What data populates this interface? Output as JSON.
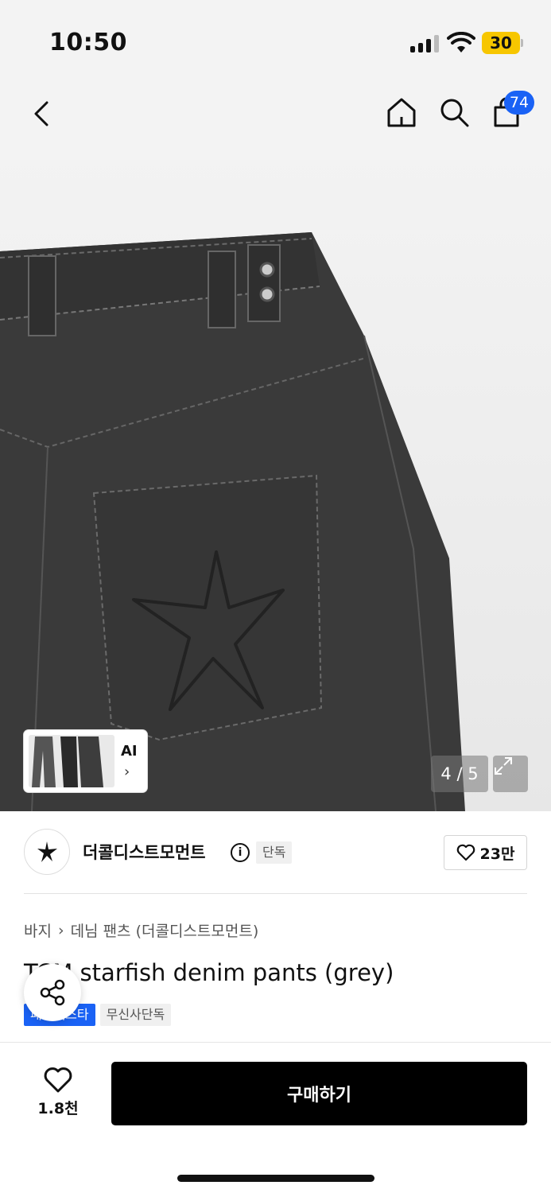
{
  "status_bar": {
    "time": "10:50",
    "battery": "30",
    "battery_color": "#f7c600",
    "icons": [
      "signal-icon",
      "wifi-icon",
      "battery-icon"
    ]
  },
  "header": {
    "icons": [
      "back-arrow-icon",
      "home-icon",
      "search-icon",
      "shopping-bag-icon"
    ],
    "cart_count": "74",
    "badge_color": "#1a62f5"
  },
  "gallery": {
    "ai_label": "AI",
    "ai_chevron": "›",
    "page_indicator": "4 / 5",
    "expand_icon": "expand-icon"
  },
  "brand": {
    "name": "더콜디스트모먼트",
    "info": "i",
    "exclusive_label": "단독",
    "like_count": "23만"
  },
  "product": {
    "breadcrumb": [
      "바지",
      "데님 팬츠 (더콜디스트모먼트)"
    ],
    "title": "TCM starfish denim pants (grey)",
    "badges": {
      "fashion": "패션페스타",
      "musinsa_exclusive": "무신사단독"
    }
  },
  "bottom_bar": {
    "wish_count": "1.8천",
    "buy_label": "구매하기"
  }
}
